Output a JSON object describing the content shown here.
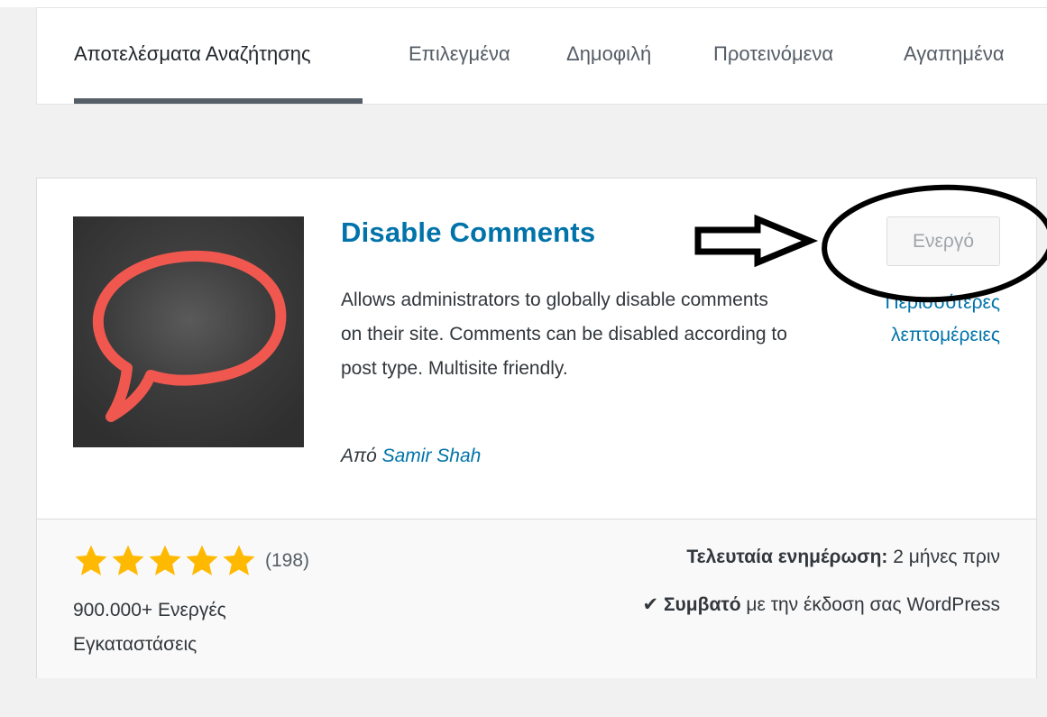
{
  "tabs": [
    {
      "label": "Αποτελέσματα Αναζήτησης",
      "active": true
    },
    {
      "label": "Επιλεγμένα",
      "active": false
    },
    {
      "label": "Δημοφιλή",
      "active": false
    },
    {
      "label": "Προτεινόμενα",
      "active": false
    },
    {
      "label": "Αγαπημένα",
      "active": false
    }
  ],
  "plugin": {
    "title": "Disable Comments",
    "description": "Allows administrators to globally disable comments on their site. Comments can be disabled according to post type. Multisite friendly.",
    "author_prefix": "Από",
    "author_name": "Samir Shah",
    "status_button": "Ενεργό",
    "more_details_line1": "Περισσότερες",
    "more_details_line2": "λεπτομέρειες",
    "rating": 5,
    "rating_count": "(198)",
    "installs_line1": "900.000+ Ενεργές",
    "installs_line2": "Εγκαταστάσεις",
    "last_updated_label": "Τελευταία ενημέρωση:",
    "last_updated_value": "2 μήνες πριν",
    "compat_check": "✔",
    "compat_strong": "Συμβατό",
    "compat_rest": "με την έκδοση σας WordPress"
  },
  "colors": {
    "link": "#0073aa",
    "star": "#ffb900",
    "icon_bg": "#3a3a3a",
    "bubble": "#f0584f"
  },
  "icons": {
    "plugin": "speech-bubble-icon",
    "rating": "star-icon",
    "compat": "checkmark-icon"
  }
}
